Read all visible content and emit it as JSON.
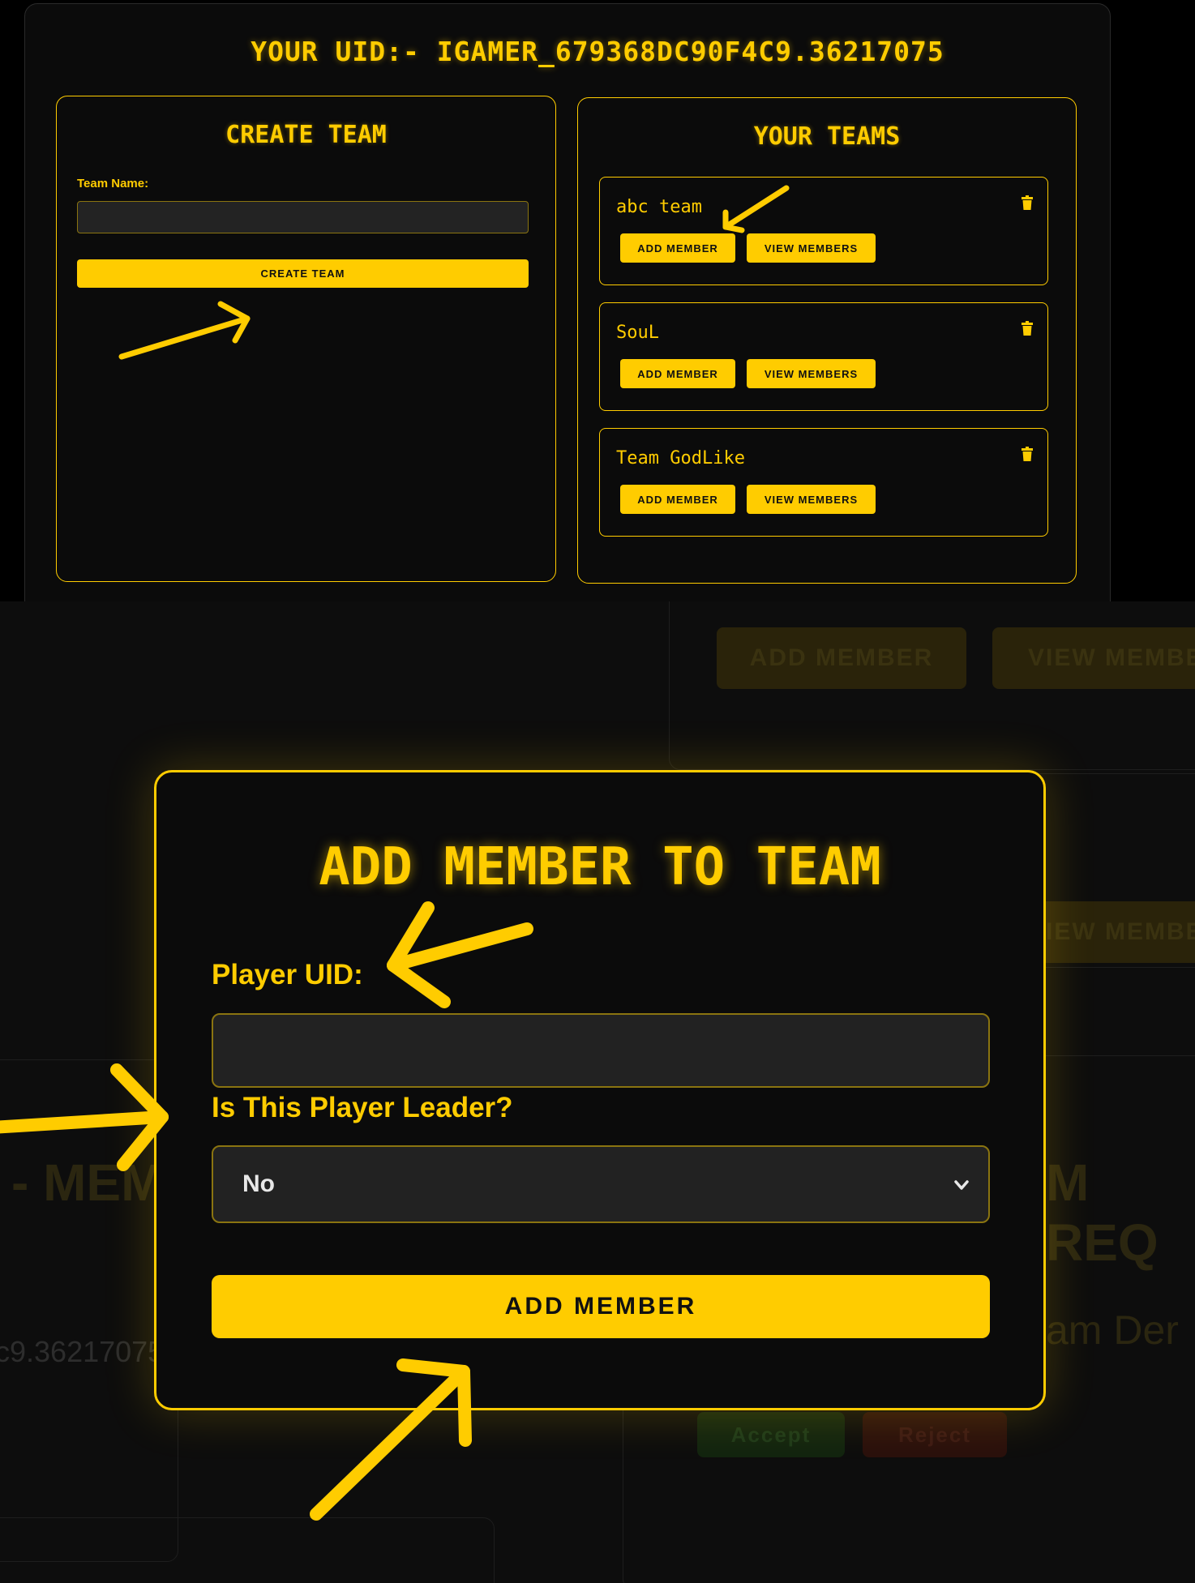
{
  "top": {
    "uid_title": "YOUR UID:- IGAMER_679368DC90F4C9.36217075",
    "create_team": {
      "title": "CREATE TEAM",
      "team_name_label": "Team Name:",
      "team_name_value": "",
      "create_button": "CREATE TEAM"
    },
    "your_teams": {
      "title": "YOUR TEAMS",
      "teams": [
        {
          "name": "abc team",
          "add_label": "ADD MEMBER",
          "view_label": "VIEW MEMBERS"
        },
        {
          "name": "SouL",
          "add_label": "ADD MEMBER",
          "view_label": "VIEW MEMBERS"
        },
        {
          "name": "Team GodLike",
          "add_label": "ADD MEMBER",
          "view_label": "VIEW MEMBERS"
        }
      ]
    }
  },
  "background": {
    "add_member": "ADD MEMBER",
    "view_members": "VIEW MEMBE",
    "view_members_2": "IEW MEMBE",
    "members_heading": "- MEM",
    "requests_heading": "M REQ",
    "uid_fragment": "c9.36217075",
    "team_fragment": "am Der",
    "accept": "Accept",
    "reject": "Reject"
  },
  "modal": {
    "title": "ADD MEMBER TO TEAM",
    "player_uid_label": "Player UID:",
    "player_uid_value": "",
    "leader_label": "Is This Player Leader?",
    "leader_selected": "No",
    "submit_button": "ADD MEMBER"
  },
  "colors": {
    "accent": "#ffcc00",
    "background": "#0b0b0b",
    "input": "#222222"
  },
  "icons": [
    "trash-icon",
    "chevron-down-icon",
    "annotation-arrow"
  ]
}
